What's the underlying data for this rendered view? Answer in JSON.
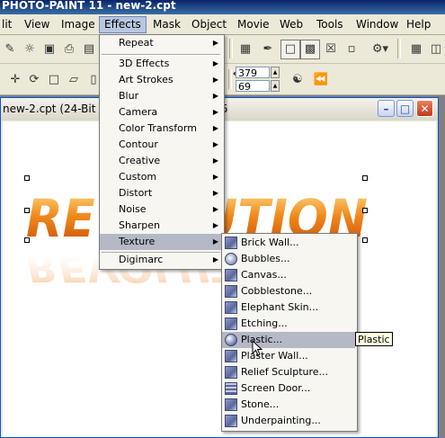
{
  "app": {
    "title": "PHOTO-PAINT 11 - new-2.cpt"
  },
  "menubar": {
    "items": [
      "lit",
      "View",
      "Image",
      "Effects",
      "Mask",
      "Object",
      "Movie",
      "Web",
      "Tools",
      "Window",
      "Help"
    ],
    "active": "Effects"
  },
  "toolbar": {
    "size_w": "379",
    "size_h": "69"
  },
  "document": {
    "title": "new-2.cpt (24-Bit",
    "title_tail": "5",
    "art_text": "REVOLUTION"
  },
  "effects_menu": {
    "items": [
      {
        "label": "Repeat",
        "submenu": true
      },
      {
        "label": "3D Effects",
        "submenu": true
      },
      {
        "label": "Art Strokes",
        "submenu": true
      },
      {
        "label": "Blur",
        "submenu": true
      },
      {
        "label": "Camera",
        "submenu": true
      },
      {
        "label": "Color Transform",
        "submenu": true
      },
      {
        "label": "Contour",
        "submenu": true
      },
      {
        "label": "Creative",
        "submenu": true
      },
      {
        "label": "Custom",
        "submenu": true
      },
      {
        "label": "Distort",
        "submenu": true
      },
      {
        "label": "Noise",
        "submenu": true
      },
      {
        "label": "Sharpen",
        "submenu": true
      },
      {
        "label": "Texture",
        "submenu": true
      },
      {
        "label": "Digimarc",
        "submenu": true
      }
    ],
    "highlighted": "Texture"
  },
  "texture_menu": {
    "items": [
      {
        "label": "Brick Wall...",
        "icon": "brick-wall-icon"
      },
      {
        "label": "Bubbles...",
        "icon": "bubbles-icon"
      },
      {
        "label": "Canvas...",
        "icon": "canvas-icon"
      },
      {
        "label": "Cobblestone...",
        "icon": "cobblestone-icon"
      },
      {
        "label": "Elephant Skin...",
        "icon": "elephant-skin-icon"
      },
      {
        "label": "Etching...",
        "icon": "etching-icon"
      },
      {
        "label": "Plastic...",
        "icon": "plastic-icon"
      },
      {
        "label": "Plaster Wall...",
        "icon": "plaster-wall-icon"
      },
      {
        "label": "Relief Sculpture...",
        "icon": "relief-sculpture-icon"
      },
      {
        "label": "Screen Door...",
        "icon": "screen-door-icon"
      },
      {
        "label": "Stone...",
        "icon": "stone-icon"
      },
      {
        "label": "Underpainting...",
        "icon": "underpainting-icon"
      }
    ],
    "highlighted": "Plastic..."
  },
  "tooltip": {
    "text": "Plastic"
  },
  "colors": {
    "menu_highlight": "#b5b9c6",
    "menu_bg": "#f7f6f1",
    "chrome": "#ece9d8",
    "title_bar": "#0a246a",
    "art_orange": "#f08a1c"
  }
}
